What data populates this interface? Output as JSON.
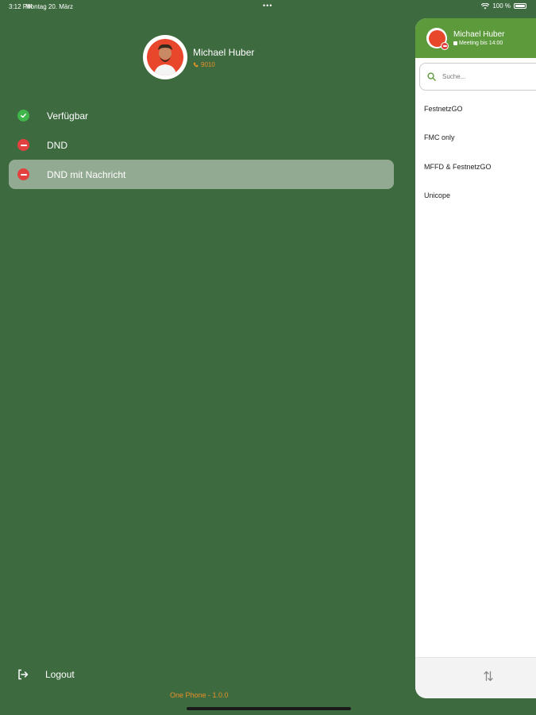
{
  "status_bar": {
    "time": "3:12 PM",
    "date": "Montag 20. März",
    "dots": "•••",
    "battery": "100 %"
  },
  "profile": {
    "name": "Michael Huber",
    "extension": "9010"
  },
  "statuses": [
    {
      "label": "Verfügbar",
      "color": "#3fb54a",
      "selected": false
    },
    {
      "label": "DND",
      "color": "#e3413f",
      "selected": false
    },
    {
      "label": "DND mit Nachricht",
      "color": "#e3413f",
      "selected": true
    }
  ],
  "logout_label": "Logout",
  "version": "One Phone - 1.0.0",
  "panel": {
    "name": "Michael Huber",
    "subtitle": "Meeting bis 14:00",
    "search_placeholder": "Suche...",
    "items": [
      "FestnetzGO",
      "FMC only",
      "MFFD & FestnetzGO",
      "Unicope"
    ]
  },
  "colors": {
    "background": "#3d6a3f",
    "panel_header": "#5c9a3c",
    "accent_orange": "#e8902a"
  }
}
